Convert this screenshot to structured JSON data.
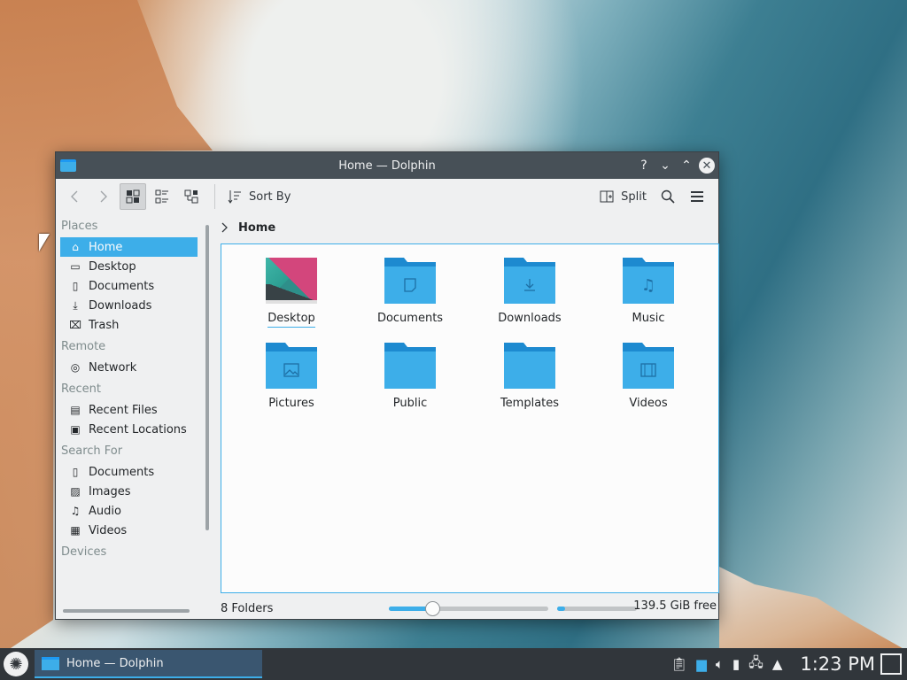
{
  "window": {
    "title": "Home — Dolphin"
  },
  "titlebar_buttons": {
    "help": "?",
    "minimize": "⌄",
    "maximize": "⌃",
    "close": "✕"
  },
  "toolbar": {
    "sort_label": "Sort By",
    "split_label": "Split"
  },
  "sidebar": {
    "places_title": "Places",
    "places": [
      {
        "label": "Home",
        "icon": "home-icon"
      },
      {
        "label": "Desktop",
        "icon": "desktop-icon"
      },
      {
        "label": "Documents",
        "icon": "documents-icon"
      },
      {
        "label": "Downloads",
        "icon": "downloads-icon"
      },
      {
        "label": "Trash",
        "icon": "trash-icon"
      }
    ],
    "remote_title": "Remote",
    "remote": [
      {
        "label": "Network",
        "icon": "network-icon"
      }
    ],
    "recent_title": "Recent",
    "recent": [
      {
        "label": "Recent Files",
        "icon": "recent-files-icon"
      },
      {
        "label": "Recent Locations",
        "icon": "recent-locations-icon"
      }
    ],
    "search_title": "Search For",
    "search": [
      {
        "label": "Documents",
        "icon": "documents-icon"
      },
      {
        "label": "Images",
        "icon": "images-icon"
      },
      {
        "label": "Audio",
        "icon": "audio-icon"
      },
      {
        "label": "Videos",
        "icon": "videos-icon"
      }
    ],
    "devices_title": "Devices"
  },
  "breadcrumb": {
    "current": "Home"
  },
  "folders": [
    {
      "label": "Desktop",
      "icon": "desktop-thumbnail"
    },
    {
      "label": "Documents",
      "icon": "documents-folder-icon"
    },
    {
      "label": "Downloads",
      "icon": "downloads-folder-icon"
    },
    {
      "label": "Music",
      "icon": "music-folder-icon"
    },
    {
      "label": "Pictures",
      "icon": "pictures-folder-icon"
    },
    {
      "label": "Public",
      "icon": "public-folder-icon"
    },
    {
      "label": "Templates",
      "icon": "templates-folder-icon"
    },
    {
      "label": "Videos",
      "icon": "videos-folder-icon"
    }
  ],
  "status": {
    "count": "8 Folders",
    "free": "139.5 GiB free",
    "zoom_fraction": 0.27,
    "used_fraction": 0.1
  },
  "taskbar": {
    "task_label": "Home — Dolphin",
    "clock": "1:23 PM"
  },
  "colors": {
    "accent": "#3daee9",
    "titlebar": "#475057",
    "panel": "#31363b"
  }
}
